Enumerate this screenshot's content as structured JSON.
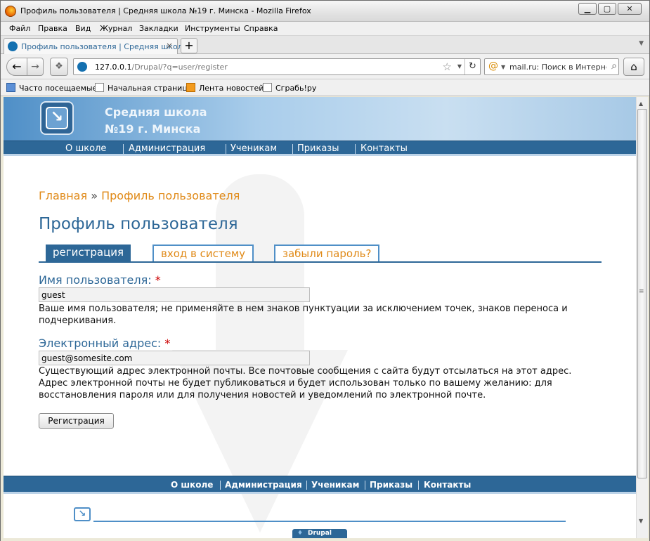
{
  "window": {
    "title": "Профиль пользователя | Средняя школа №19 г. Минска - Mozilla Firefox",
    "minimize": "▁",
    "maximize": "▢",
    "close": "✕"
  },
  "menu": [
    "Файл",
    "Правка",
    "Вид",
    "Журнал",
    "Закладки",
    "Инструменты",
    "Справка"
  ],
  "tab": {
    "label": "Профиль пользователя | Средняя школа ...",
    "close": "×",
    "new_tab": "+"
  },
  "nav": {
    "back": "←",
    "forward": "→",
    "extension": "❖",
    "url_host": "127.0.0.1",
    "url_path": "/Drupal/?q=user/register",
    "star": "☆",
    "reload": "↻",
    "search_placeholder": "mail.ru: Поиск в Интернете",
    "search_engine": "@",
    "search": "⌕",
    "home": "⌂"
  },
  "bookmarks": [
    "Часто посещаемые",
    "Начальная страница",
    "Лента новостей",
    "Сграбь!ру"
  ],
  "site": {
    "name_line1": "Средняя школа",
    "name_line2": "№19 г. Минска",
    "logo_glyph": "↘",
    "nav": [
      "О школе",
      "Администрация",
      "Ученикам",
      "Приказы",
      "Контакты"
    ]
  },
  "breadcrumb": {
    "home": "Главная",
    "separator": "»",
    "current": "Профиль пользователя"
  },
  "page_title": "Профиль пользователя",
  "tabs": [
    "регистрация",
    "вход в систему",
    "забыли пароль?"
  ],
  "form": {
    "username_label": "Имя пользователя:",
    "required_mark": "*",
    "username_value": "guest",
    "username_desc": "Ваше имя пользователя; не применяйте в нем знаков пунктуации за исключением точек, знаков переноса и подчеркивания.",
    "email_label": "Электронный адрес:",
    "email_value": "guest@somesite.com",
    "email_desc": "Существующий адрес электронной почты. Все почтовые сообщения с сайта будут отсылаться на этот адрес. Адрес электронной почты не будет публиковаться и будет использован только по вашему желанию: для восстановления пароля или для получения новостей и уведомлений по электронной почте.",
    "submit": "Регистрация"
  },
  "footer": {
    "nav": [
      "О школе",
      "Администрация",
      "Ученикам",
      "Приказы",
      "Контакты"
    ],
    "logo_glyph": "↘",
    "powered_by": "Drupal"
  }
}
